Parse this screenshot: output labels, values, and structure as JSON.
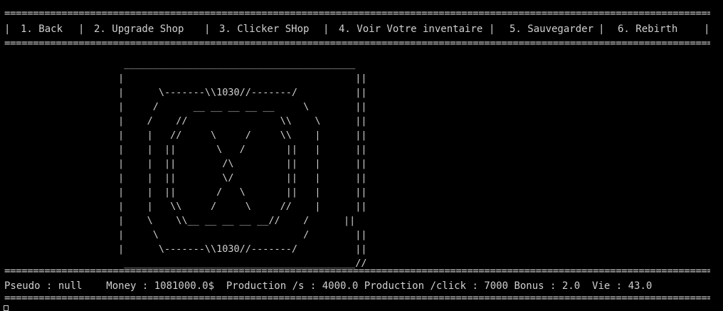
{
  "separator": "=============================================================================================================================",
  "menu": {
    "pipe": "|",
    "items": [
      {
        "label": "1. Back"
      },
      {
        "label": "2. Upgrade Shop"
      },
      {
        "label": "3. Clicker SHop"
      },
      {
        "label": "4. Voir Votre inventaire"
      },
      {
        "label": "5. Sauvegarder"
      },
      {
        "label": "6. Rebirth"
      }
    ]
  },
  "art": {
    "lines": [
      " ________________________________________",
      "|                                        ||",
      "|      \\-------\\\\1030//-------/          ||",
      "|     /      __ __ __ __ __     \\        ||",
      "|    /    //                \\\\    \\      ||",
      "|    |   //     \\     /     \\\\    |      ||",
      "|    |  ||       \\   /       ||   |      ||",
      "|    |  ||        /\\         ||   |      ||",
      "|    |  ||        \\/         ||   |      ||",
      "|    |  ||       /   \\       ||   |      ||",
      "|    |   \\\\     /     \\     //    |      ||",
      "|    \\    \\\\__ __ __ __ __//    /      ||",
      "|     \\                         /        ||",
      "|      \\-------\\\\1030//-------/          ||",
      " ________________________________________//"
    ]
  },
  "status": {
    "text": "Pseudo : null    Money : 1081000.0$  Production /s : 4000.0 Production /click : 7000 Bonus : 2.0  Vie : 43.0"
  }
}
